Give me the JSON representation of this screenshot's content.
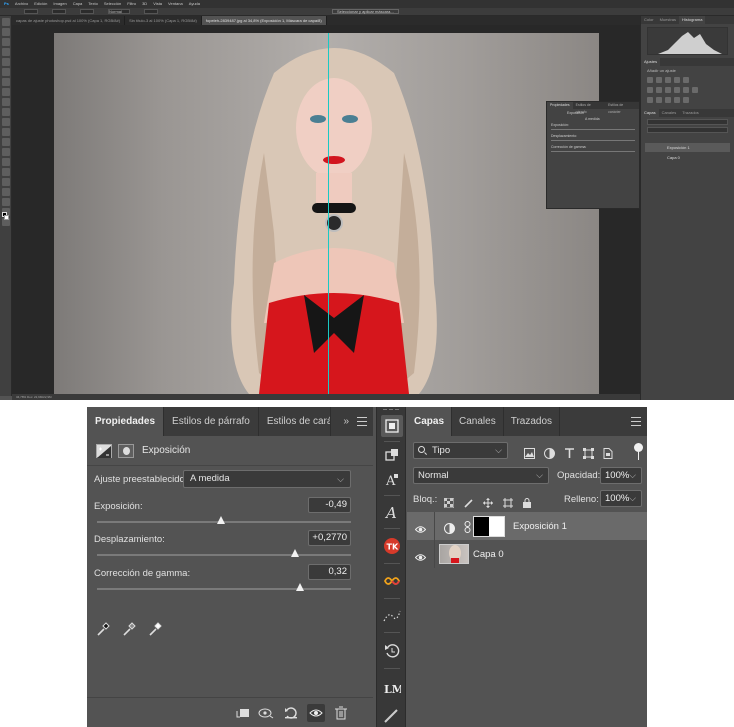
{
  "top": {
    "menu": [
      "Archivo",
      "Edición",
      "Imagen",
      "Capa",
      "Texto",
      "Selección",
      "Filtro",
      "3D",
      "Vista",
      "Ventana",
      "Ayuda"
    ],
    "options": {
      "mode_label": "Normal",
      "select_mask_btn": "Seleccionar y aplicar máscara..."
    },
    "doc_tabs": [
      {
        "label": "capas de ajuste photoshop.psd al 100% (Capa 1, RGB/8#)",
        "active": false
      },
      {
        "label": "Sin título-3 al 100% (Capa 1, RGB/8#)",
        "active": false
      },
      {
        "label": "fopeleh-2839487.jpg al 34,8% (Exposición 1, Máscara de capa/8)",
        "active": true
      }
    ],
    "status": "34,78%     Doc: 22,9M/22,9M",
    "right_panel": {
      "top_tabs": [
        "Color",
        "Muestras",
        "Histograma"
      ],
      "adj_tabs": [
        "Ajustes"
      ],
      "adj_hint": "Añadir un ajuste",
      "layers_tabs": [
        "Capas",
        "Canales",
        "Trazados"
      ],
      "layers": [
        "Exposición 1",
        "Capa 0"
      ]
    },
    "float_props": {
      "tabs": [
        "Propiedades",
        "Estilos de párrafo",
        "Estilos de carácter"
      ],
      "title": "Exposición",
      "preset": "A medida",
      "rows": [
        {
          "label": "Exposición:",
          "value": "-0,49"
        },
        {
          "label": "Desplazamiento:",
          "value": "+0,2770"
        },
        {
          "label": "Corrección de gamma:",
          "value": "0,32"
        }
      ]
    }
  },
  "properties": {
    "tabs": [
      "Propiedades",
      "Estilos de párrafo",
      "Estilos de carácter"
    ],
    "overflow": "»",
    "title": "Exposición",
    "preset_label": "Ajuste preestablecido:",
    "preset_value": "A medida",
    "sliders": [
      {
        "label": "Exposición:",
        "value": "-0,49",
        "position": 0.49
      },
      {
        "label": "Desplazamiento:",
        "value": "+0,2770",
        "position": 0.78
      },
      {
        "label": "Corrección de gamma:",
        "value": "0,32",
        "position": 0.8
      }
    ]
  },
  "layers": {
    "tabs": [
      "Capas",
      "Canales",
      "Trazados"
    ],
    "filter_value": "Tipo",
    "blend_mode": "Normal",
    "opacity_label": "Opacidad:",
    "opacity_value": "100%",
    "lock_label": "Bloq.:",
    "fill_label": "Relleno:",
    "fill_value": "100%",
    "items": [
      {
        "name": "Exposición 1",
        "selected": true
      },
      {
        "name": "Capa 0",
        "selected": false
      }
    ]
  },
  "colors": {
    "accent_divider": "#19c9c4",
    "panel_bg": "#535353",
    "tab_bar": "#3b3b3b",
    "selected_layer": "#6a6a6a"
  }
}
